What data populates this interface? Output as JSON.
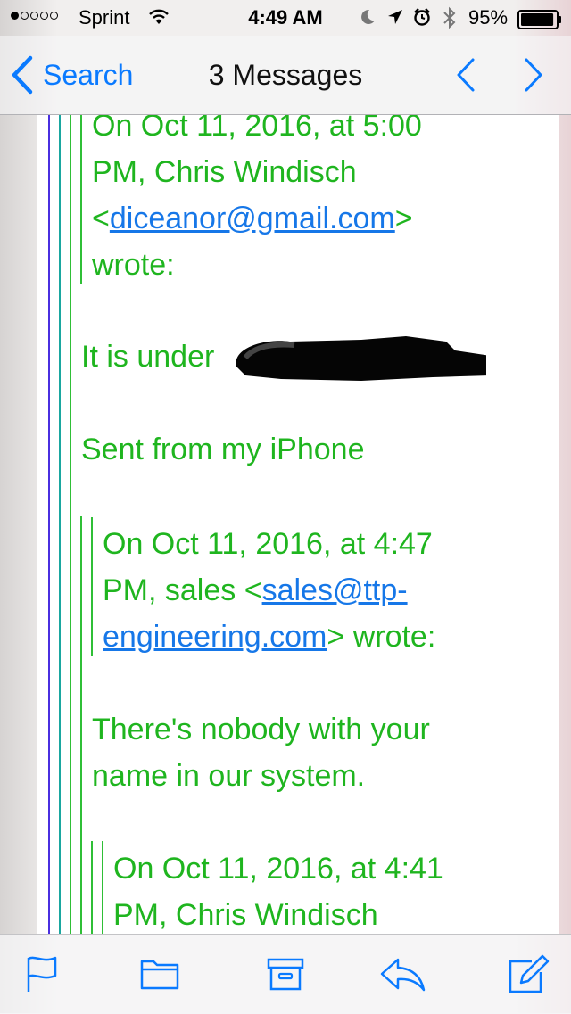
{
  "status": {
    "carrier": "Sprint",
    "time": "4:49 AM",
    "battery": "95%",
    "battery_level": 0.95
  },
  "nav": {
    "back_label": "Search",
    "title": "3 Messages"
  },
  "messages": {
    "header1": {
      "line1": "On Oct 11, 2016, at 5:00",
      "line2": "PM, Chris Windisch",
      "lt": "<",
      "email": "diceanor@gmail.com",
      "gt": ">",
      "line4": "wrote:"
    },
    "body1": "It is under",
    "sent": "Sent from my iPhone",
    "header2": {
      "line1": "On Oct 11, 2016, at 4:47",
      "line2a": "PM, sales <",
      "email_part1": "sales@ttp-",
      "email_part2": "engineering.com",
      "line3b": "> wrote:"
    },
    "body2_line1": "There's nobody with your",
    "body2_line2": "name in our system.",
    "header3": {
      "line1": "On Oct 11, 2016, at 4:41",
      "line2": "PM, Chris Windisch"
    }
  },
  "colors": {
    "quote_text": "#1fb51f",
    "link": "#1677e8",
    "accent": "#0a7aff",
    "quote_bar_blue": "#4a2fe0",
    "quote_bar_teal": "#1aa7a0",
    "quote_bar_green": "#2fbf36"
  },
  "icons": {
    "back": "chevron-left-icon",
    "prev": "chevron-left-icon",
    "next": "chevron-right-icon",
    "toolbar": [
      "flag-icon",
      "folder-icon",
      "archive-icon",
      "reply-icon",
      "compose-icon"
    ]
  }
}
